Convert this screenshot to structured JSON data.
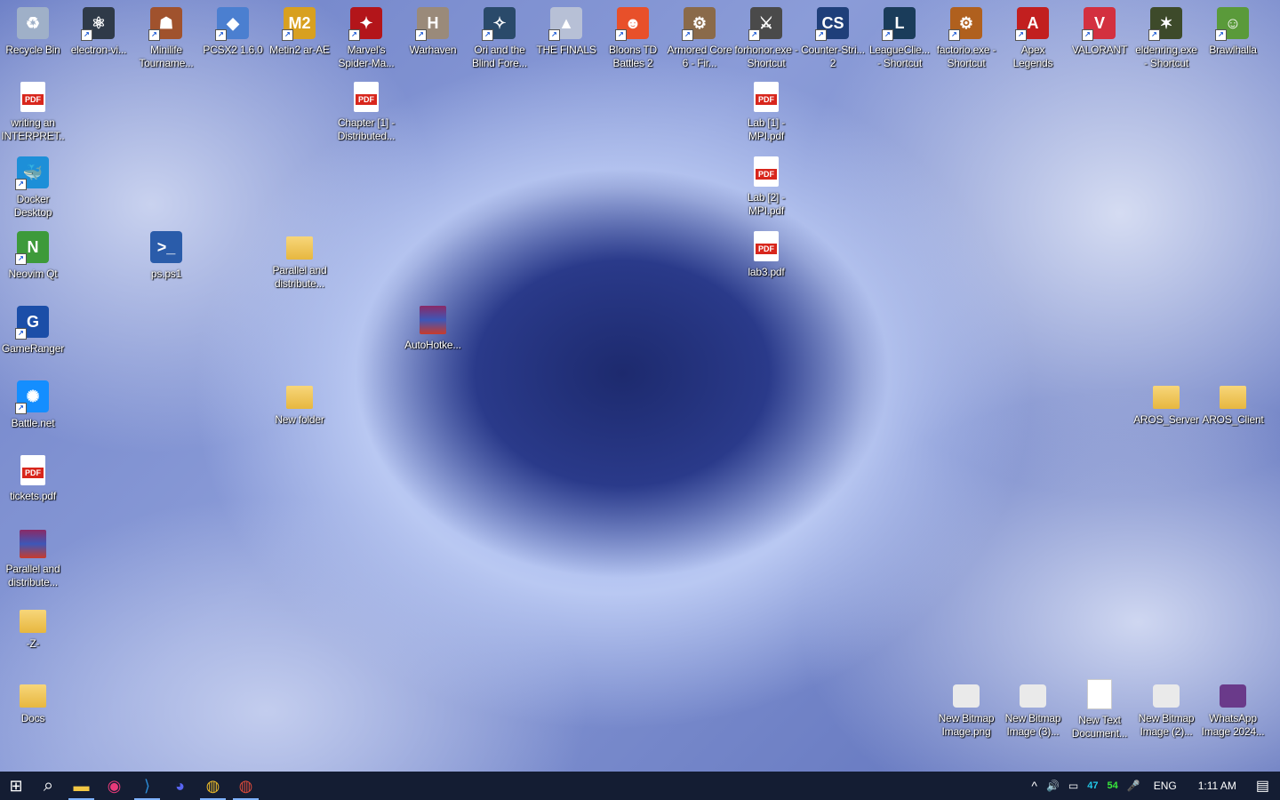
{
  "desktop": {
    "icons": [
      {
        "label": "Recycle Bin",
        "glyph": "♻",
        "color": "#9fb0c8",
        "shortcut": false
      },
      {
        "label": "electron-vi...",
        "glyph": "⚛",
        "color": "#2f3a48",
        "shortcut": true
      },
      {
        "label": "Minilife Tourname...",
        "glyph": "☗",
        "color": "#a0522d",
        "shortcut": true
      },
      {
        "label": "PCSX2 1.6.0",
        "glyph": "◆",
        "color": "#4b7fd0",
        "shortcut": true
      },
      {
        "label": "Metin2 ar-AE",
        "glyph": "M2",
        "color": "#d8a020",
        "shortcut": true
      },
      {
        "label": "Marvel's Spider-Ma...",
        "glyph": "✦",
        "color": "#b3151a",
        "shortcut": true
      },
      {
        "label": "Warhaven",
        "glyph": "H",
        "color": "#9a8a7a",
        "shortcut": true
      },
      {
        "label": "Ori and the Blind Fore...",
        "glyph": "✧",
        "color": "#2a4a6a",
        "shortcut": true
      },
      {
        "label": "THE FINALS",
        "glyph": "▲",
        "color": "#b7c0d6",
        "shortcut": true
      },
      {
        "label": "Bloons TD Battles 2",
        "glyph": "☻",
        "color": "#e8502a",
        "shortcut": true
      },
      {
        "label": "Armored Core 6 - Fir...",
        "glyph": "⚙",
        "color": "#8a6a4a",
        "shortcut": true
      },
      {
        "label": "forhonor.exe - Shortcut",
        "glyph": "⚔",
        "color": "#4a4a4a",
        "shortcut": true
      },
      {
        "label": "Counter-Stri... 2",
        "glyph": "CS",
        "color": "#1f3f7a",
        "shortcut": true
      },
      {
        "label": "LeagueClie... - Shortcut",
        "glyph": "L",
        "color": "#1a3c5a",
        "shortcut": true
      },
      {
        "label": "factorio.exe - Shortcut",
        "glyph": "⚙",
        "color": "#b0601e",
        "shortcut": true
      },
      {
        "label": "Apex Legends",
        "glyph": "A",
        "color": "#c21f1f",
        "shortcut": true
      },
      {
        "label": "VALORANT",
        "glyph": "V",
        "color": "#d3303f",
        "shortcut": true
      },
      {
        "label": "eldenring.exe - Shortcut",
        "glyph": "✶",
        "color": "#3d4a2a",
        "shortcut": true
      },
      {
        "label": "Brawlhalla",
        "glyph": "☺",
        "color": "#5a9a3a",
        "shortcut": true
      },
      {
        "label": "writing an INTERPRET...",
        "glyph": "PDF",
        "color": "#d8261c",
        "shortcut": false
      },
      {
        "label": "Chapter [1] - Distributed...",
        "glyph": "PDF",
        "color": "#d8261c",
        "shortcut": false
      },
      {
        "label": "Lab [1] - MPI.pdf",
        "glyph": "PDF",
        "color": "#d8261c",
        "shortcut": false
      },
      {
        "label": "Docker Desktop",
        "glyph": "🐳",
        "color": "#1d8fd8",
        "shortcut": true
      },
      {
        "label": "Lab [2] - MPI.pdf",
        "glyph": "PDF",
        "color": "#d8261c",
        "shortcut": false
      },
      {
        "label": "Neovim Qt",
        "glyph": "N",
        "color": "#3d9a3a",
        "shortcut": true
      },
      {
        "label": "ps.ps1",
        "glyph": ">_",
        "color": "#2a5caa",
        "shortcut": false
      },
      {
        "label": "Parallel and distribute...",
        "glyph": "folder",
        "color": "#e7b73f",
        "shortcut": false
      },
      {
        "label": "lab3.pdf",
        "glyph": "PDF",
        "color": "#d8261c",
        "shortcut": false
      },
      {
        "label": "GameRanger",
        "glyph": "G",
        "color": "#1b4ea8",
        "shortcut": true
      },
      {
        "label": "AutoHotke...",
        "glyph": "rar",
        "color": "#8a2a66",
        "shortcut": false
      },
      {
        "label": "Battle.net",
        "glyph": "✺",
        "color": "#148eff",
        "shortcut": true
      },
      {
        "label": "New folder",
        "glyph": "folder",
        "color": "#e7b73f",
        "shortcut": false
      },
      {
        "label": "AROS_Server",
        "glyph": "folder",
        "color": "#e7b73f",
        "shortcut": false
      },
      {
        "label": "AROS_Client",
        "glyph": "folder",
        "color": "#e7b73f",
        "shortcut": false
      },
      {
        "label": "tickets.pdf",
        "glyph": "PDF",
        "color": "#d8261c",
        "shortcut": false
      },
      {
        "label": "Parallel and distribute...",
        "glyph": "rar",
        "color": "#8a2a66",
        "shortcut": false
      },
      {
        "label": "-Z-",
        "glyph": "folder",
        "color": "#e7b73f",
        "shortcut": false
      },
      {
        "label": "Docs",
        "glyph": "folder",
        "color": "#e7b73f",
        "shortcut": false
      },
      {
        "label": "New Bitmap Image.png",
        "glyph": "img",
        "color": "#eaeaea",
        "shortcut": false
      },
      {
        "label": "New Bitmap Image (3)...",
        "glyph": "img",
        "color": "#eaeaea",
        "shortcut": false
      },
      {
        "label": "New Text Document...",
        "glyph": "doc",
        "color": "#ffffff",
        "shortcut": false
      },
      {
        "label": "New Bitmap Image (2)...",
        "glyph": "img",
        "color": "#eaeaea",
        "shortcut": false
      },
      {
        "label": "WhatsApp Image 2024...",
        "glyph": "img",
        "color": "#6a3a8a",
        "shortcut": false
      }
    ]
  },
  "taskbar": {
    "start": "⊞",
    "search": "⌕",
    "apps": [
      {
        "name": "File Explorer",
        "glyph": "▬",
        "color": "#f2c744",
        "active": true
      },
      {
        "name": "App",
        "glyph": "◉",
        "color": "#e83a7a",
        "active": false
      },
      {
        "name": "Visual Studio Code",
        "glyph": "⟩",
        "color": "#2c8bd6",
        "active": true
      },
      {
        "name": "Discord",
        "glyph": "◕",
        "color": "#5865f2",
        "active": false
      },
      {
        "name": "Chrome",
        "glyph": "◍",
        "color": "#e8b82a",
        "active": true
      },
      {
        "name": "Chrome 2",
        "glyph": "◍",
        "color": "#d94a3a",
        "active": true
      }
    ],
    "tray": {
      "chevron": "^",
      "volume": "🔊",
      "network": "▭",
      "cyan_value": "47",
      "green_value": "54",
      "mic": "🎤",
      "language": "ENG",
      "time": "1:11 AM",
      "notification": "▤"
    }
  }
}
